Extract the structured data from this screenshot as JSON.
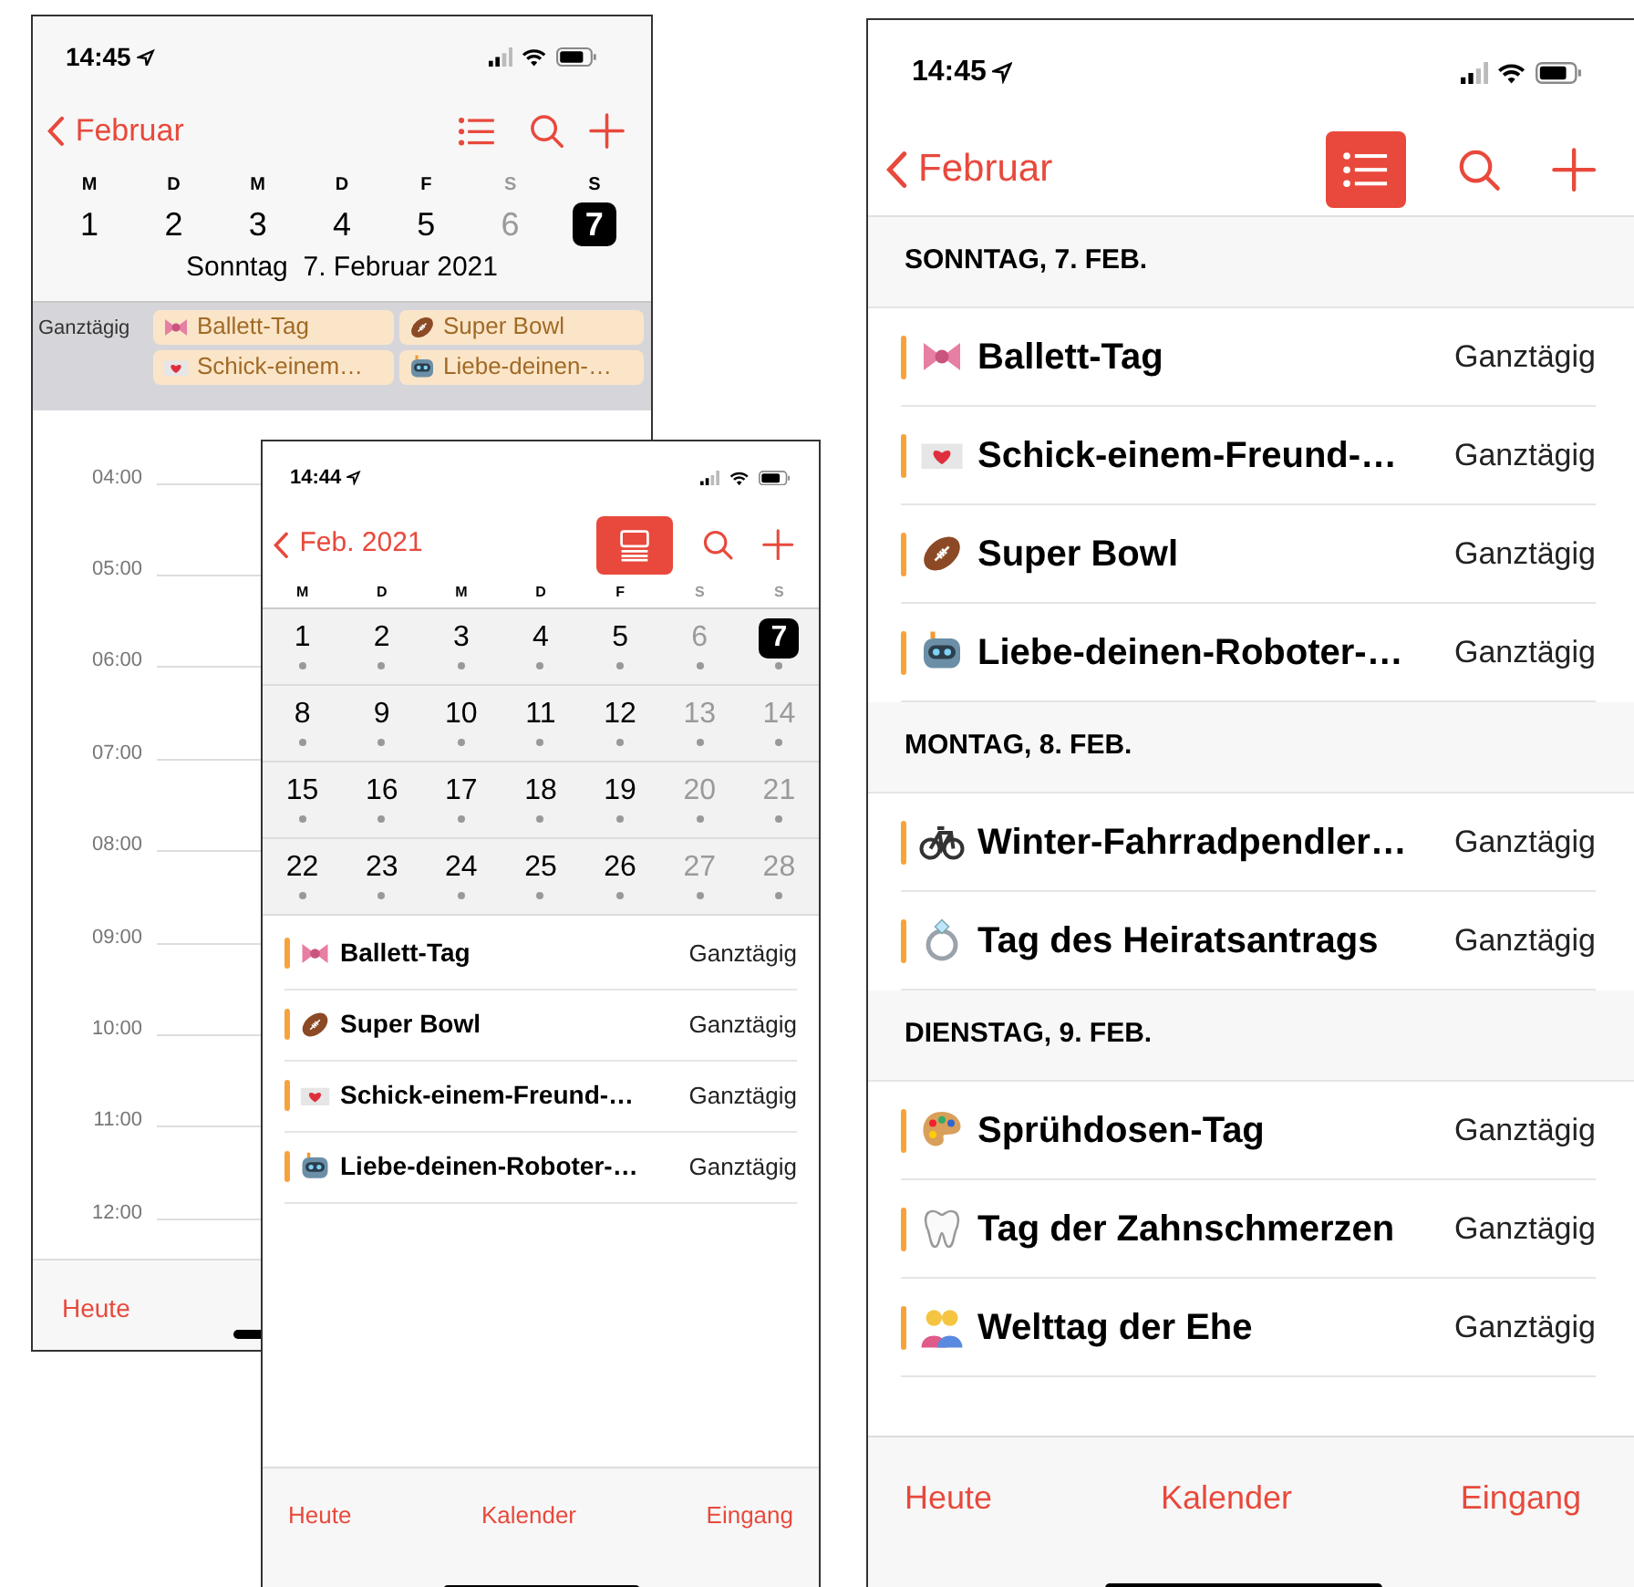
{
  "day_view_phone": {
    "status_bar": {
      "time": "14:45"
    },
    "nav": {
      "back_label": "Februar",
      "view_button": {
        "kind": "list",
        "selected": false
      }
    },
    "week": [
      {
        "weekday": "M",
        "day": "1",
        "dimmed": false,
        "selected": false
      },
      {
        "weekday": "D",
        "day": "2",
        "dimmed": false,
        "selected": false
      },
      {
        "weekday": "M",
        "day": "3",
        "dimmed": false,
        "selected": false
      },
      {
        "weekday": "D",
        "day": "4",
        "dimmed": false,
        "selected": false
      },
      {
        "weekday": "F",
        "day": "5",
        "dimmed": false,
        "selected": false
      },
      {
        "weekday": "S",
        "day": "6",
        "dimmed": true,
        "selected": false
      },
      {
        "weekday": "S",
        "day": "7",
        "dimmed": false,
        "selected": true
      }
    ],
    "date_title": "Sonntag  7. Februar 2021",
    "all_day": {
      "label": "Ganztägig",
      "events": [
        {
          "kind": "bow",
          "title": "Ballett-Tag"
        },
        {
          "kind": "football",
          "title": "Super Bowl"
        },
        {
          "kind": "love-letter",
          "title": "Schick-einem…"
        },
        {
          "kind": "robot",
          "title": "Liebe-deinen-…"
        }
      ]
    },
    "hours": [
      "04:00",
      "05:00",
      "06:00",
      "07:00",
      "08:00",
      "09:00",
      "10:00",
      "11:00",
      "12:00"
    ],
    "tab_bar": [
      "Heute"
    ]
  },
  "month_view_phone": {
    "status_bar": {
      "time": "14:44"
    },
    "nav": {
      "back_label": "Feb. 2021",
      "view_button": {
        "kind": "month-list",
        "selected": true
      }
    },
    "weekdays": [
      {
        "label": "M",
        "dimmed": false
      },
      {
        "label": "D",
        "dimmed": false
      },
      {
        "label": "M",
        "dimmed": false
      },
      {
        "label": "D",
        "dimmed": false
      },
      {
        "label": "F",
        "dimmed": false
      },
      {
        "label": "S",
        "dimmed": true
      },
      {
        "label": "S",
        "dimmed": true
      }
    ],
    "weeks": [
      [
        {
          "day": "1",
          "dimmed": false,
          "selected": false,
          "has_events": true
        },
        {
          "day": "2",
          "dimmed": false,
          "selected": false,
          "has_events": true
        },
        {
          "day": "3",
          "dimmed": false,
          "selected": false,
          "has_events": true
        },
        {
          "day": "4",
          "dimmed": false,
          "selected": false,
          "has_events": true
        },
        {
          "day": "5",
          "dimmed": false,
          "selected": false,
          "has_events": true
        },
        {
          "day": "6",
          "dimmed": true,
          "selected": false,
          "has_events": true
        },
        {
          "day": "7",
          "dimmed": false,
          "selected": true,
          "has_events": true
        }
      ],
      [
        {
          "day": "8",
          "dimmed": false,
          "selected": false,
          "has_events": true
        },
        {
          "day": "9",
          "dimmed": false,
          "selected": false,
          "has_events": true
        },
        {
          "day": "10",
          "dimmed": false,
          "selected": false,
          "has_events": true
        },
        {
          "day": "11",
          "dimmed": false,
          "selected": false,
          "has_events": true
        },
        {
          "day": "12",
          "dimmed": false,
          "selected": false,
          "has_events": true
        },
        {
          "day": "13",
          "dimmed": true,
          "selected": false,
          "has_events": true
        },
        {
          "day": "14",
          "dimmed": true,
          "selected": false,
          "has_events": true
        }
      ],
      [
        {
          "day": "15",
          "dimmed": false,
          "selected": false,
          "has_events": true
        },
        {
          "day": "16",
          "dimmed": false,
          "selected": false,
          "has_events": true
        },
        {
          "day": "17",
          "dimmed": false,
          "selected": false,
          "has_events": true
        },
        {
          "day": "18",
          "dimmed": false,
          "selected": false,
          "has_events": true
        },
        {
          "day": "19",
          "dimmed": false,
          "selected": false,
          "has_events": true
        },
        {
          "day": "20",
          "dimmed": true,
          "selected": false,
          "has_events": true
        },
        {
          "day": "21",
          "dimmed": true,
          "selected": false,
          "has_events": true
        }
      ],
      [
        {
          "day": "22",
          "dimmed": false,
          "selected": false,
          "has_events": true
        },
        {
          "day": "23",
          "dimmed": false,
          "selected": false,
          "has_events": true
        },
        {
          "day": "24",
          "dimmed": false,
          "selected": false,
          "has_events": true
        },
        {
          "day": "25",
          "dimmed": false,
          "selected": false,
          "has_events": true
        },
        {
          "day": "26",
          "dimmed": false,
          "selected": false,
          "has_events": true
        },
        {
          "day": "27",
          "dimmed": true,
          "selected": false,
          "has_events": true
        },
        {
          "day": "28",
          "dimmed": true,
          "selected": false,
          "has_events": true
        }
      ]
    ],
    "events": [
      {
        "kind": "bow",
        "title": "Ballett-Tag",
        "time": "Ganztägig"
      },
      {
        "kind": "football",
        "title": "Super Bowl",
        "time": "Ganztägig"
      },
      {
        "kind": "love-letter",
        "title": "Schick-einem-Freund-…",
        "time": "Ganztägig"
      },
      {
        "kind": "robot",
        "title": "Liebe-deinen-Roboter-…",
        "time": "Ganztägig"
      }
    ],
    "tab_bar": [
      "Heute",
      "Kalender",
      "Eingang"
    ]
  },
  "list_view_phone": {
    "status_bar": {
      "time": "14:45"
    },
    "nav": {
      "back_label": "Februar",
      "view_button": {
        "kind": "list",
        "selected": true
      }
    },
    "sections": [
      {
        "header": "SONNTAG, 7. FEB.",
        "events": [
          {
            "kind": "bow",
            "title": "Ballett-Tag",
            "time": "Ganztägig"
          },
          {
            "kind": "love-letter",
            "title": "Schick-einem-Freund-…",
            "time": "Ganztägig"
          },
          {
            "kind": "football",
            "title": "Super Bowl",
            "time": "Ganztägig"
          },
          {
            "kind": "robot",
            "title": "Liebe-deinen-Roboter-…",
            "time": "Ganztägig"
          }
        ]
      },
      {
        "header": "MONTAG, 8. FEB.",
        "events": [
          {
            "kind": "bicycle",
            "title": "Winter-Fahrradpendler…",
            "time": "Ganztägig"
          },
          {
            "kind": "ring",
            "title": "Tag des Heiratsantrags",
            "time": "Ganztägig"
          }
        ]
      },
      {
        "header": "DIENSTAG, 9. FEB.",
        "events": [
          {
            "kind": "palette",
            "title": "Sprühdosen-Tag",
            "time": "Ganztägig"
          },
          {
            "kind": "tooth",
            "title": "Tag der Zahnschmerzen",
            "time": "Ganztägig"
          },
          {
            "kind": "people",
            "title": "Welttag der Ehe",
            "time": "Ganztägig"
          }
        ]
      }
    ],
    "tab_bar": [
      "Heute",
      "Kalender",
      "Eingang"
    ]
  }
}
